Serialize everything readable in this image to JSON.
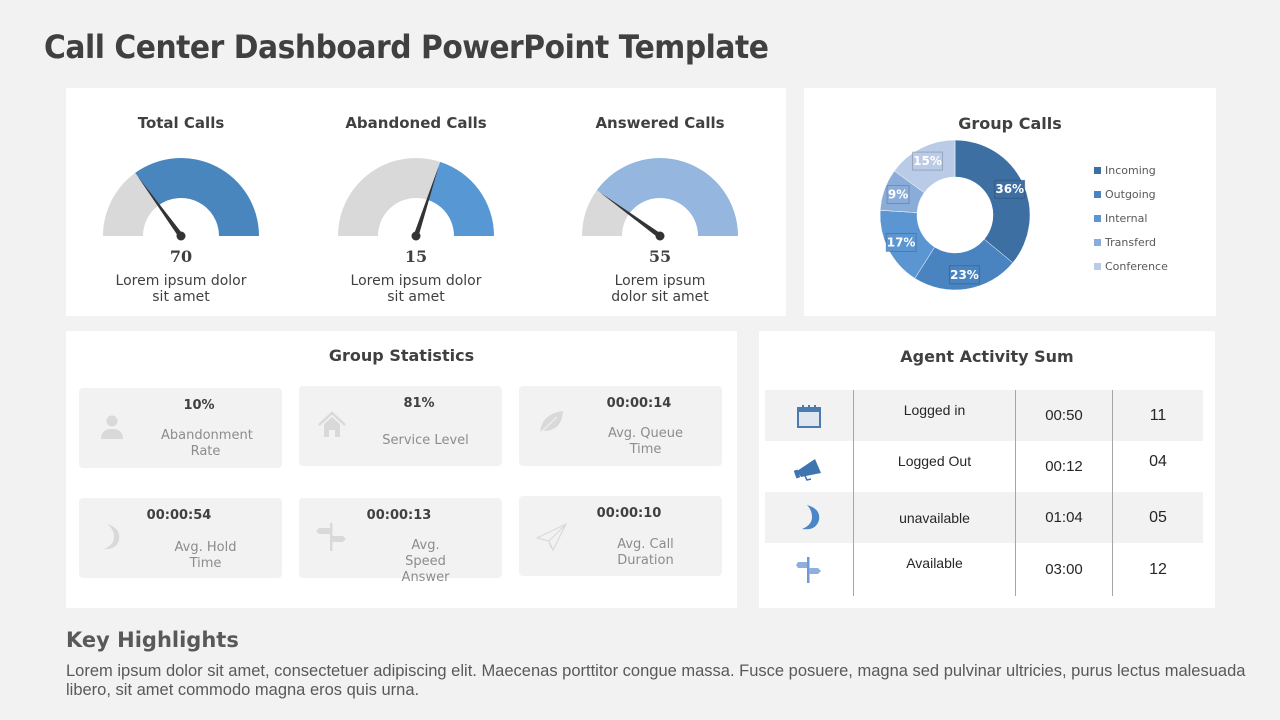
{
  "title": "Call Center Dashboard PowerPoint Template",
  "gauges": [
    {
      "title": "Total Calls",
      "value": "70",
      "fraction": 0.7,
      "description": "Lorem ipsum dolor sit amet",
      "color": "#4a86be"
    },
    {
      "title": "Abandoned Calls",
      "value": "15",
      "fraction": 0.4,
      "description": "Lorem ipsum dolor sit amet",
      "color": "#5797d4"
    },
    {
      "title": "Answered Calls",
      "value": "55",
      "fraction": 0.8,
      "description": "Lorem ipsum dolor sit amet",
      "color": "#95b6df"
    }
  ],
  "group_calls": {
    "title": "Group Calls",
    "chart_data": {
      "type": "pie",
      "title": "Group Calls",
      "categories": [
        "Incoming",
        "Outgoing",
        "Internal",
        "Transferd",
        "Conference"
      ],
      "values": [
        36,
        23,
        17,
        9,
        15
      ],
      "labels": [
        "36%",
        "23%",
        "17%",
        "9%",
        "15%"
      ],
      "colors": [
        "#3e6fa3",
        "#4a84c0",
        "#5b96d2",
        "#8aacd9",
        "#b9cbe6"
      ],
      "legend": "right",
      "donut": true
    }
  },
  "group_statistics": {
    "title": "Group Statistics",
    "cards": [
      {
        "value": "10%",
        "label": "Abandonment Rate",
        "icon": "user-icon"
      },
      {
        "value": "81%",
        "label": "Service Level",
        "icon": "home-icon"
      },
      {
        "value": "00:00:14",
        "label": "Avg. Queue Time",
        "icon": "leaf-icon"
      },
      {
        "value": "00:00:54",
        "label": "Avg. Hold Time",
        "icon": "moon-icon"
      },
      {
        "value": "00:00:13",
        "label": "Avg. Speed Answer",
        "icon": "signpost-icon"
      },
      {
        "value": "00:00:10",
        "label": "Avg. Call Duration",
        "icon": "paper-plane-icon"
      }
    ]
  },
  "agent_activity": {
    "title": "Agent Activity  Sum",
    "rows": [
      {
        "icon": "calendar-icon",
        "label": "Logged in",
        "time": "00:50",
        "count": "11"
      },
      {
        "icon": "megaphone-icon",
        "label": "Logged Out",
        "time": "00:12",
        "count": "04"
      },
      {
        "icon": "moon-icon",
        "label": "unavailable",
        "time": "01:04",
        "count": "05"
      },
      {
        "icon": "signpost-icon",
        "label": "Available",
        "time": "03:00",
        "count": "12"
      }
    ]
  },
  "key_highlights": {
    "title": "Key Highlights",
    "text": "Lorem ipsum dolor sit amet, consectetuer adipiscing elit. Maecenas porttitor congue massa. Fusce posuere, magna sed pulvinar ultricies, purus lectus malesuada libero, sit amet commodo magna eros quis urna."
  }
}
